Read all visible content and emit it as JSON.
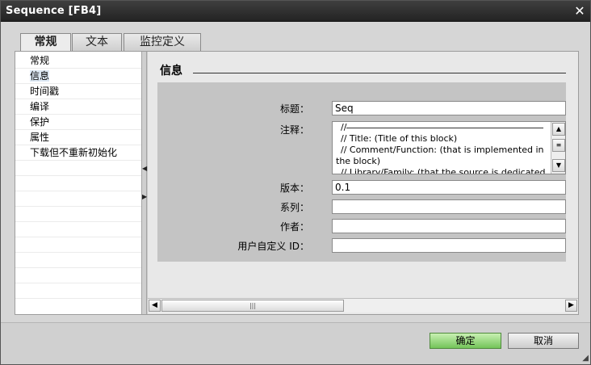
{
  "window": {
    "title": "Sequence [FB4]"
  },
  "tabs": [
    {
      "label": "常规",
      "active": true
    },
    {
      "label": "文本",
      "active": false
    },
    {
      "label": "监控定义",
      "active": false
    }
  ],
  "sidebar": {
    "items": [
      {
        "label": "常规"
      },
      {
        "label": "信息",
        "selected": true
      },
      {
        "label": "时间戳"
      },
      {
        "label": "编译"
      },
      {
        "label": "保护"
      },
      {
        "label": "属性"
      },
      {
        "label": "下载但不重新初始化"
      }
    ]
  },
  "section": {
    "title": "信息"
  },
  "form": {
    "title_label": "标题：",
    "title_value": "Seq",
    "comment_label": "注释：",
    "comment_lines": [
      "//",
      "// Title:          (Title of this block)",
      "// Comment/Function: (that is implemented in",
      "the block)",
      "// Library/Family:   (that the source is dedicated"
    ],
    "version_label": "版本：",
    "version_value": "0.1",
    "family_label": "系列：",
    "family_value": "",
    "author_label": "作者：",
    "author_value": "",
    "userid_label": "用户自定义 ID：",
    "userid_value": ""
  },
  "buttons": {
    "ok": "确定",
    "cancel": "取消"
  },
  "colors": {
    "ok_button": "#74c45a",
    "titlebar": "#2d2d2d"
  },
  "icons": {
    "close": "close-icon",
    "scroll_up": "chevron-up-icon",
    "scroll_down": "chevron-down-icon",
    "scroll_left": "chevron-left-icon",
    "scroll_right": "chevron-right-icon"
  }
}
